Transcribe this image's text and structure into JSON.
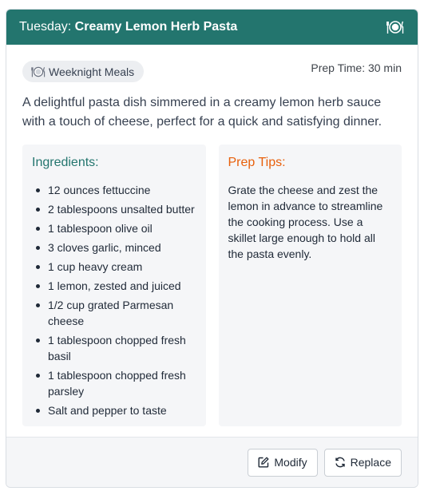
{
  "header": {
    "day": "Tuesday:",
    "recipe_name": "Creamy Lemon Herb Pasta",
    "icon": "plate-cutlery-icon"
  },
  "meta": {
    "category": "Weeknight Meals",
    "category_icon": "plate-cutlery-icon",
    "prep_time": "Prep Time: 30 min"
  },
  "description": "A delightful pasta dish simmered in a creamy lemon herb sauce with a touch of cheese, perfect for a quick and satisfying dinner.",
  "ingredients": {
    "title": "Ingredients:",
    "items": [
      "12 ounces fettuccine",
      "2 tablespoons unsalted butter",
      "1 tablespoon olive oil",
      "3 cloves garlic, minced",
      "1 cup heavy cream",
      "1 lemon, zested and juiced",
      "1/2 cup grated Parmesan cheese",
      "1 tablespoon chopped fresh basil",
      "1 tablespoon chopped fresh parsley",
      "Salt and pepper to taste"
    ]
  },
  "tips": {
    "title": "Prep Tips:",
    "text": "Grate the cheese and zest the lemon in advance to streamline the cooking process. Use a skillet large enough to hold all the pasta evenly."
  },
  "footer": {
    "modify_label": "Modify",
    "modify_icon": "edit-icon",
    "replace_label": "Replace",
    "replace_icon": "refresh-icon"
  },
  "colors": {
    "header_bg": "#23756e",
    "ingredients_title": "#23756e",
    "tips_title": "#e8600c"
  }
}
